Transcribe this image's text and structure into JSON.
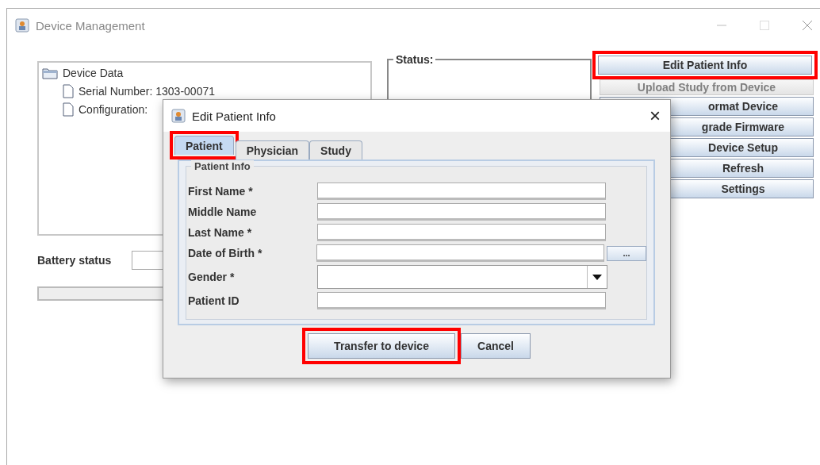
{
  "window": {
    "title": "Device Management"
  },
  "tree": {
    "label": "Device Data",
    "expanded": true,
    "children": [
      {
        "label": "Serial Number: 1303-00071"
      },
      {
        "label": "Configuration:"
      }
    ]
  },
  "status": {
    "legend": "Status:"
  },
  "actions": [
    {
      "label": "Edit Patient Info",
      "disabled": false,
      "highlighted": true
    },
    {
      "label": "Upload  Study from Device",
      "disabled": true,
      "highlighted": false
    },
    {
      "label": "ormat Device",
      "disabled": false,
      "highlighted": false
    },
    {
      "label": "grade Firmware",
      "disabled": false,
      "highlighted": false
    },
    {
      "label": "Device Setup",
      "disabled": false,
      "highlighted": false
    },
    {
      "label": "Refresh",
      "disabled": false,
      "highlighted": false
    },
    {
      "label": "Settings",
      "disabled": false,
      "highlighted": false
    }
  ],
  "battery": {
    "label": "Battery status"
  },
  "progress": {
    "level": 0
  },
  "dialog": {
    "title": "Edit Patient Info",
    "close": "×",
    "tabs": [
      {
        "label": "Patient",
        "selected": true,
        "highlighted": true
      },
      {
        "label": "Physician",
        "selected": false,
        "highlighted": false
      },
      {
        "label": "Study",
        "selected": false,
        "highlighted": false
      }
    ],
    "group": "Patient Info",
    "fields": [
      {
        "label": "First Name *",
        "kind": "text"
      },
      {
        "label": "Middle Name",
        "kind": "text"
      },
      {
        "label": "Last Name *",
        "kind": "text"
      },
      {
        "label": "Date of Birth *",
        "kind": "date",
        "button": "..."
      },
      {
        "label": "Gender *",
        "kind": "select"
      },
      {
        "label": "Patient ID",
        "kind": "text"
      }
    ],
    "buttons": [
      {
        "label": "Transfer to device",
        "highlighted": true
      },
      {
        "label": "Cancel",
        "highlighted": false
      }
    ]
  }
}
